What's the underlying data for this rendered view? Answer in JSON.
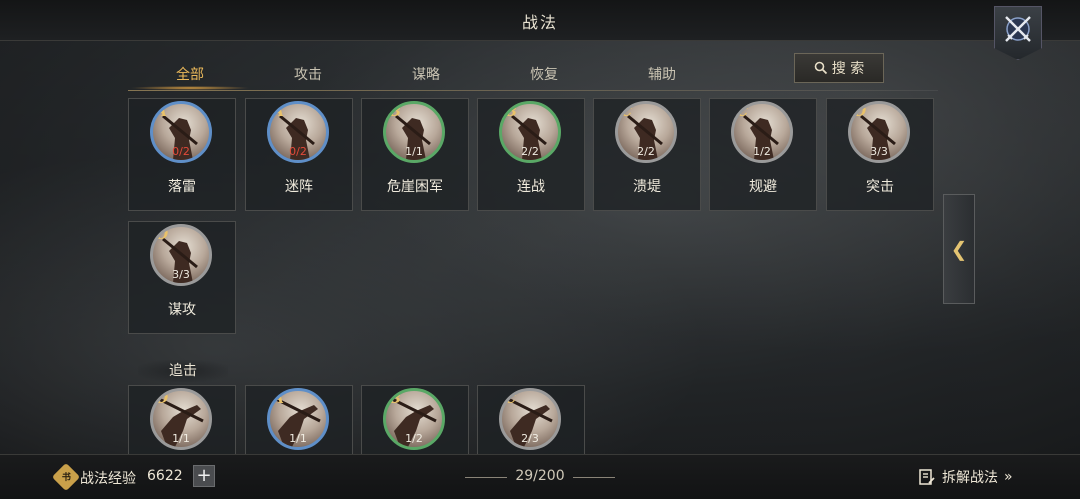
{
  "header": {
    "title": "战法"
  },
  "tabs": [
    {
      "label": "全部",
      "active": true
    },
    {
      "label": "攻击"
    },
    {
      "label": "谋略"
    },
    {
      "label": "恢复"
    },
    {
      "label": "辅助"
    }
  ],
  "search": {
    "label": "搜 索"
  },
  "cards": [
    {
      "grade": "A",
      "count": "0/2",
      "name": "落雷"
    },
    {
      "grade": "A",
      "count": "0/2",
      "name": "迷阵"
    },
    {
      "grade": "B",
      "count": "1/1",
      "name": "危崖困军"
    },
    {
      "grade": "B",
      "count": "2/2",
      "name": "连战"
    },
    {
      "grade": "C",
      "count": "2/2",
      "name": "溃堤"
    },
    {
      "grade": "C",
      "count": "1/2",
      "name": "规避"
    },
    {
      "grade": "D",
      "count": "3/3",
      "name": "突击"
    },
    {
      "grade": "D",
      "count": "3/3",
      "name": "谋攻"
    }
  ],
  "section2": {
    "label": "追击",
    "cards": [
      {
        "grade": "D",
        "count": "1/1"
      },
      {
        "grade": "A",
        "count": "1/1"
      },
      {
        "grade": "B",
        "count": "1/2"
      },
      {
        "grade": "C",
        "count": "2/3"
      }
    ]
  },
  "collapse": {
    "glyph": "❮"
  },
  "footer": {
    "exp_icon": "书",
    "exp_label": "战法经验",
    "exp_value": "6622",
    "plus": "+",
    "page_count": "29/200",
    "disassemble_label": "拆解战法",
    "disassemble_arrow": "»"
  }
}
